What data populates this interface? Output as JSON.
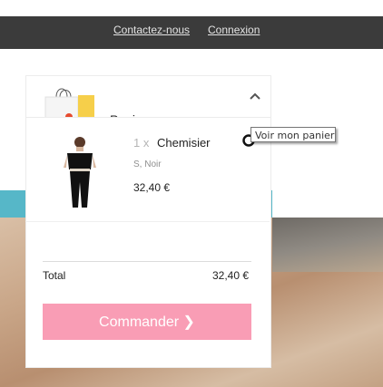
{
  "topbar": {
    "contact_label": "Contactez-nous",
    "login_label": "Connexion"
  },
  "cart": {
    "title": "Panier",
    "bag_icon": "shopping-bag-icon",
    "toggle_icon": "chevron-up-icon",
    "item": {
      "quantity": "1 x",
      "name": "Chemisier",
      "variant": "S, Noir",
      "price": "32,40 €"
    },
    "total_label": "Total",
    "total_value": "32,40 €",
    "order_button_label": "Commander ❯"
  },
  "tooltip": {
    "text": "Voir mon panier"
  },
  "colors": {
    "topbar": "#3b3b3b",
    "order_button": "#f99db5",
    "teal_banner": "#56b7c8"
  }
}
